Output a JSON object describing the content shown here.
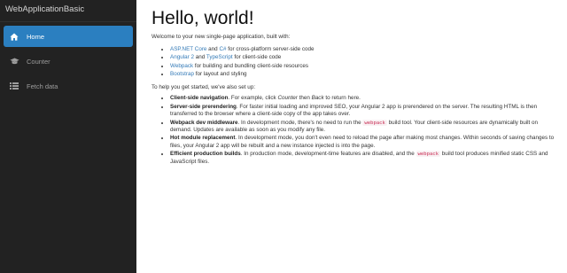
{
  "app": {
    "brand": "WebApplicationBasic"
  },
  "sidebar": {
    "items": [
      {
        "label": "Home",
        "icon": "home-icon"
      },
      {
        "label": "Counter",
        "icon": "graduation-cap-icon"
      },
      {
        "label": "Fetch data",
        "icon": "list-icon"
      }
    ]
  },
  "main": {
    "title": "Hello, world!",
    "intro": "Welcome to your new single-page application, built with:",
    "tech": [
      {
        "links": [
          "ASP.NET Core",
          "C#"
        ],
        "joiner": " and ",
        "rest": " for cross-platform server-side code"
      },
      {
        "links": [
          "Angular 2",
          "TypeScript"
        ],
        "joiner": " and ",
        "rest": " for client-side code"
      },
      {
        "links": [
          "Webpack"
        ],
        "rest": " for building and bundling client-side resources"
      },
      {
        "links": [
          "Bootstrap"
        ],
        "rest": " for layout and styling"
      }
    ],
    "setup_intro": "To help you get started, we've also set up:",
    "features": [
      {
        "title": "Client-side navigation",
        "parts": [
          ". For example, click ",
          {
            "em": "Counter"
          },
          " then ",
          {
            "em": "Back"
          },
          " to return here."
        ]
      },
      {
        "title": "Server-side prerendering",
        "parts": [
          ". For faster initial loading and improved SEO, your Angular 2 app is prerendered on the server. The resulting HTML is then transferred to the browser where a client-side copy of the app takes over."
        ]
      },
      {
        "title": "Webpack dev middleware",
        "parts": [
          ". In development mode, there's no need to run the ",
          {
            "code": "webpack"
          },
          " build tool. Your client-side resources are dynamically built on demand. Updates are available as soon as you modify any file."
        ]
      },
      {
        "title": "Hot module replacement",
        "parts": [
          ". In development mode, you don't even need to reload the page after making most changes. Within seconds of saving changes to files, your Angular 2 app will be rebuilt and a new instance injected is into the page."
        ]
      },
      {
        "title": "Efficient production builds",
        "parts": [
          ". In production mode, development-time features are disabled, and the ",
          {
            "code": "webpack"
          },
          " build tool produces minified static CSS and JavaScript files."
        ]
      }
    ]
  }
}
